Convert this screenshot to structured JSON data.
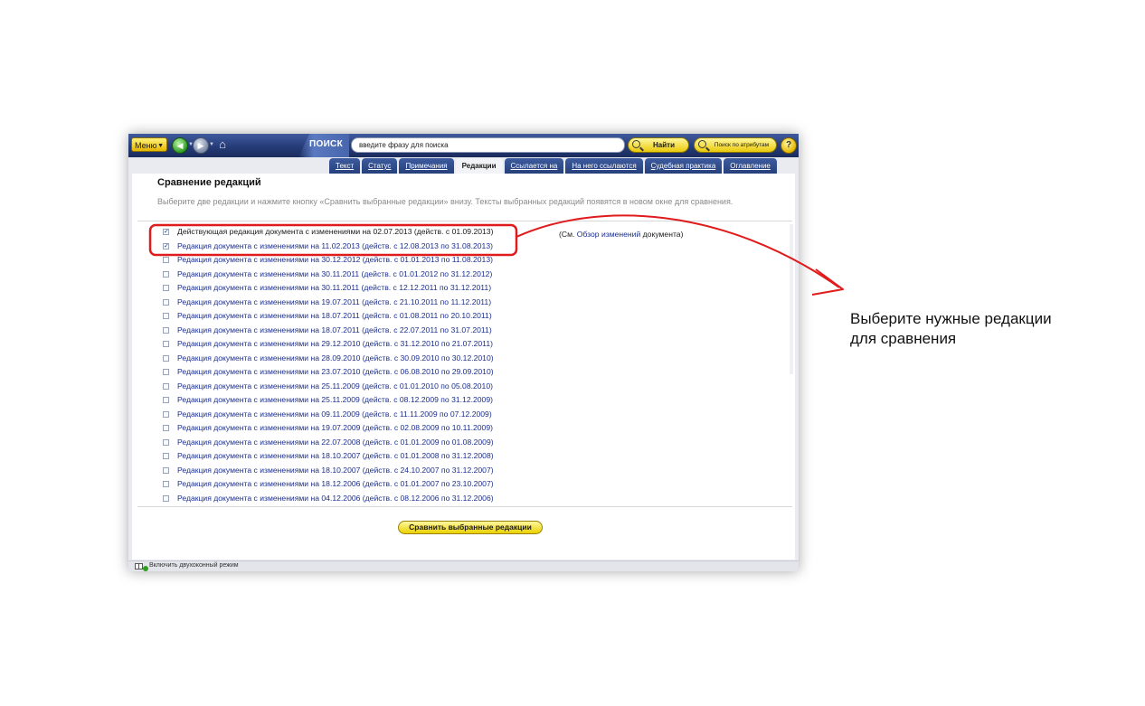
{
  "toolbar": {
    "menu_label": "Меню",
    "search_label": "ПОИСК",
    "search_placeholder": "введите фразу для поиска",
    "find_label": "Найти",
    "attr_search_label": "Поиск по атрибутам",
    "help_label": "?"
  },
  "tabs": [
    {
      "label": "Текст",
      "active": false
    },
    {
      "label": "Статус",
      "active": false
    },
    {
      "label": "Примечания",
      "active": false
    },
    {
      "label": "Редакции",
      "active": true
    },
    {
      "label": "Ссылается на",
      "active": false
    },
    {
      "label": "На него ссылаются",
      "active": false
    },
    {
      "label": "Судебная практика",
      "active": false
    },
    {
      "label": "Оглавление",
      "active": false
    }
  ],
  "page": {
    "title": "Сравнение редакций",
    "instructions": "Выберите две редакции и нажмите кнопку «Сравнить выбранные редакции» внизу. Тексты выбранных редакций появятся в новом окне для сравнения.",
    "see_prefix": "(См.",
    "see_link": "Обзор изменений",
    "see_suffix": "документа)",
    "compare_button": "Сравнить выбранные редакции"
  },
  "editions": [
    {
      "label": "Действующая редакция документа с изменениями на 02.07.2013 (действ. с 01.09.2013)",
      "checked": true,
      "current": true
    },
    {
      "label": "Редакция документа с изменениями на 11.02.2013 (действ. с 12.08.2013 по 31.08.2013)",
      "checked": true,
      "current": false
    },
    {
      "label": "Редакция документа с изменениями на 30.12.2012 (действ. с 01.01.2013 по 11.08.2013)",
      "checked": false,
      "current": false
    },
    {
      "label": "Редакция документа с изменениями на 30.11.2011 (действ. с 01.01.2012 по 31.12.2012)",
      "checked": false,
      "current": false
    },
    {
      "label": "Редакция документа с изменениями на 30.11.2011 (действ. с 12.12.2011 по 31.12.2011)",
      "checked": false,
      "current": false
    },
    {
      "label": "Редакция документа с изменениями на 19.07.2011 (действ. с 21.10.2011 по 11.12.2011)",
      "checked": false,
      "current": false
    },
    {
      "label": "Редакция документа с изменениями на 18.07.2011 (действ. с 01.08.2011 по 20.10.2011)",
      "checked": false,
      "current": false
    },
    {
      "label": "Редакция документа с изменениями на 18.07.2011 (действ. с 22.07.2011 по 31.07.2011)",
      "checked": false,
      "current": false
    },
    {
      "label": "Редакция документа с изменениями на 29.12.2010 (действ. с 31.12.2010 по 21.07.2011)",
      "checked": false,
      "current": false
    },
    {
      "label": "Редакция документа с изменениями на 28.09.2010 (действ. с 30.09.2010 по 30.12.2010)",
      "checked": false,
      "current": false
    },
    {
      "label": "Редакция документа с изменениями на 23.07.2010 (действ. с 06.08.2010 по 29.09.2010)",
      "checked": false,
      "current": false
    },
    {
      "label": "Редакция документа с изменениями на 25.11.2009 (действ. с 01.01.2010 по 05.08.2010)",
      "checked": false,
      "current": false
    },
    {
      "label": "Редакция документа с изменениями на 25.11.2009 (действ. с 08.12.2009 по 31.12.2009)",
      "checked": false,
      "current": false
    },
    {
      "label": "Редакция документа с изменениями на 09.11.2009 (действ. с 11.11.2009 по 07.12.2009)",
      "checked": false,
      "current": false
    },
    {
      "label": "Редакция документа с изменениями на 19.07.2009 (действ. с 02.08.2009 по 10.11.2009)",
      "checked": false,
      "current": false
    },
    {
      "label": "Редакция документа с изменениями на 22.07.2008 (действ. с 01.01.2009 по 01.08.2009)",
      "checked": false,
      "current": false
    },
    {
      "label": "Редакция документа с изменениями на 18.10.2007 (действ. с 01.01.2008 по 31.12.2008)",
      "checked": false,
      "current": false
    },
    {
      "label": "Редакция документа с изменениями на 18.10.2007 (действ. с 24.10.2007 по 31.12.2007)",
      "checked": false,
      "current": false
    },
    {
      "label": "Редакция документа с изменениями на 18.12.2006 (действ. с 01.01.2007 по 23.10.2007)",
      "checked": false,
      "current": false
    },
    {
      "label": "Редакция документа с изменениями на 04.12.2006 (действ. с 08.12.2006 по 31.12.2006)",
      "checked": false,
      "current": false
    }
  ],
  "status_bar": {
    "dual_window_label": "Включить двухоконный режим"
  },
  "annotation": {
    "line1": "Выберите нужные редакции",
    "line2": "для сравнения",
    "color": "#e01b1b"
  }
}
